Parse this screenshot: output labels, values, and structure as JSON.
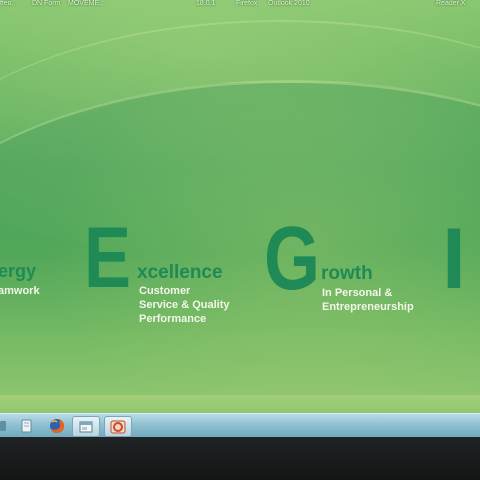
{
  "desktop": {
    "icons": [
      {
        "label": "ffeo...",
        "x_hint": "left"
      },
      {
        "label": "DN Form"
      },
      {
        "label": "MOVEME..."
      },
      {
        "label": "18.0.1"
      },
      {
        "label": "Firefox"
      },
      {
        "label": "Outlook 2010"
      },
      {
        "label": "Reader X"
      }
    ]
  },
  "wallpaper": {
    "values": [
      {
        "letter": "",
        "word": "ergy",
        "subtitle": "amwork"
      },
      {
        "letter": "E",
        "word": "xcellence",
        "subtitle_lines": [
          "Customer",
          "Service & Quality",
          "Performance"
        ]
      },
      {
        "letter": "G",
        "word": "rowth",
        "subtitle_lines": [
          "In Personal &",
          "Entrepreneurship"
        ]
      },
      {
        "letter": "I"
      }
    ]
  },
  "taskbar": {
    "items": [
      {
        "icon": "windows-explorer-icon"
      },
      {
        "icon": "firefox-icon"
      },
      {
        "icon": "app-window-icon"
      },
      {
        "icon": "office-icon"
      }
    ]
  },
  "colors": {
    "wallpaper_green": "#4fa65a",
    "letter_green": "#1f8a55",
    "taskbar_blue": "#8fc0d1"
  }
}
